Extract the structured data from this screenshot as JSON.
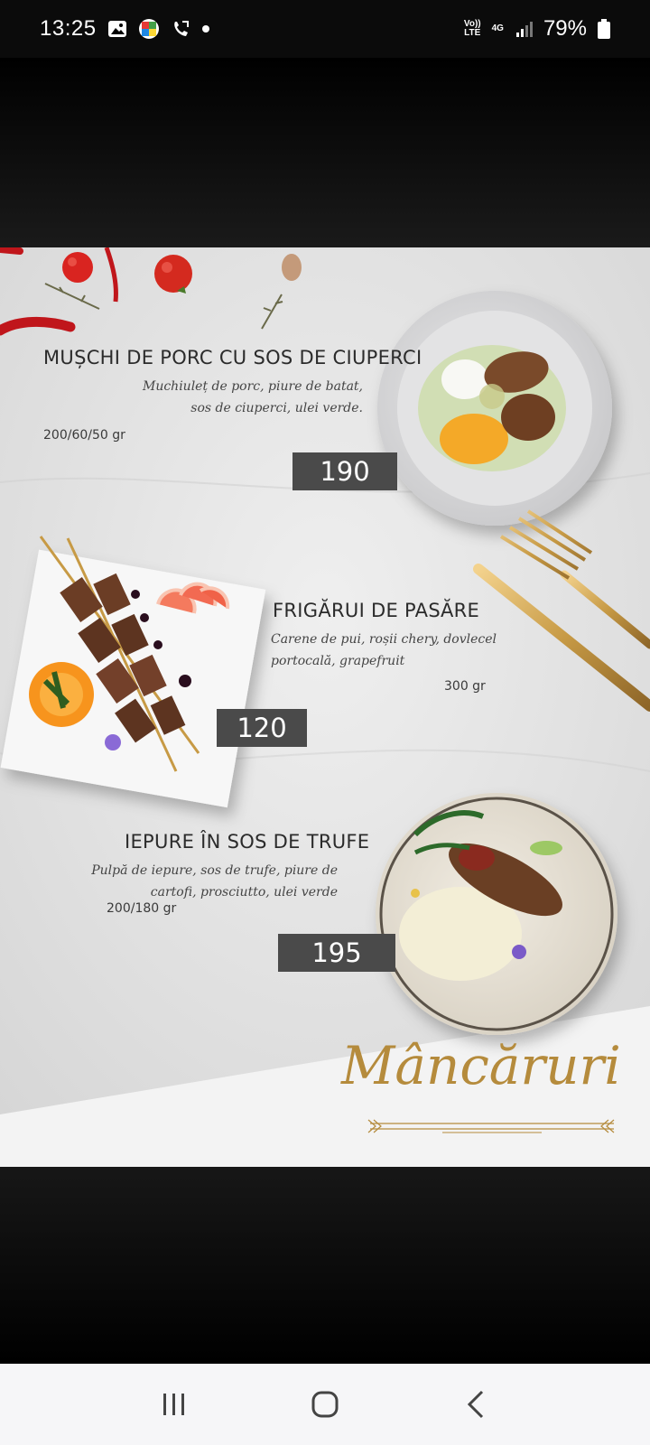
{
  "status": {
    "time": "13:25",
    "volte": "Vo)) LTE",
    "network": "4G",
    "battery_pct": "79%"
  },
  "menu": {
    "section_title": "Mâncăruri",
    "dishes": [
      {
        "title": "MUȘCHI DE PORC CU SOS DE CIUPERCI",
        "desc1": "Muchiuleț de porc, piure de batat,",
        "desc2": "sos de ciuperci, ulei verde.",
        "weight": "200/60/50 gr",
        "price": "190"
      },
      {
        "title": "FRIGĂRUI DE PASĂRE",
        "desc1": "Carene de pui, roșii chery, dovlecel",
        "desc2": "portocală, grapefruit",
        "weight": "300 gr",
        "price": "120"
      },
      {
        "title": "IEPURE ÎN SOS DE TRUFE",
        "desc1": "Pulpă de iepure, sos de trufe, piure de",
        "desc2": "cartofi, prosciutto, ulei verde",
        "weight": "200/180 gr",
        "price": "195"
      }
    ]
  },
  "icons": {
    "gallery": "image-icon",
    "app": "colorful-app-icon",
    "call": "call-forward-icon",
    "nav_recent": "recent-apps-icon",
    "nav_home": "home-icon",
    "nav_back": "back-icon"
  }
}
